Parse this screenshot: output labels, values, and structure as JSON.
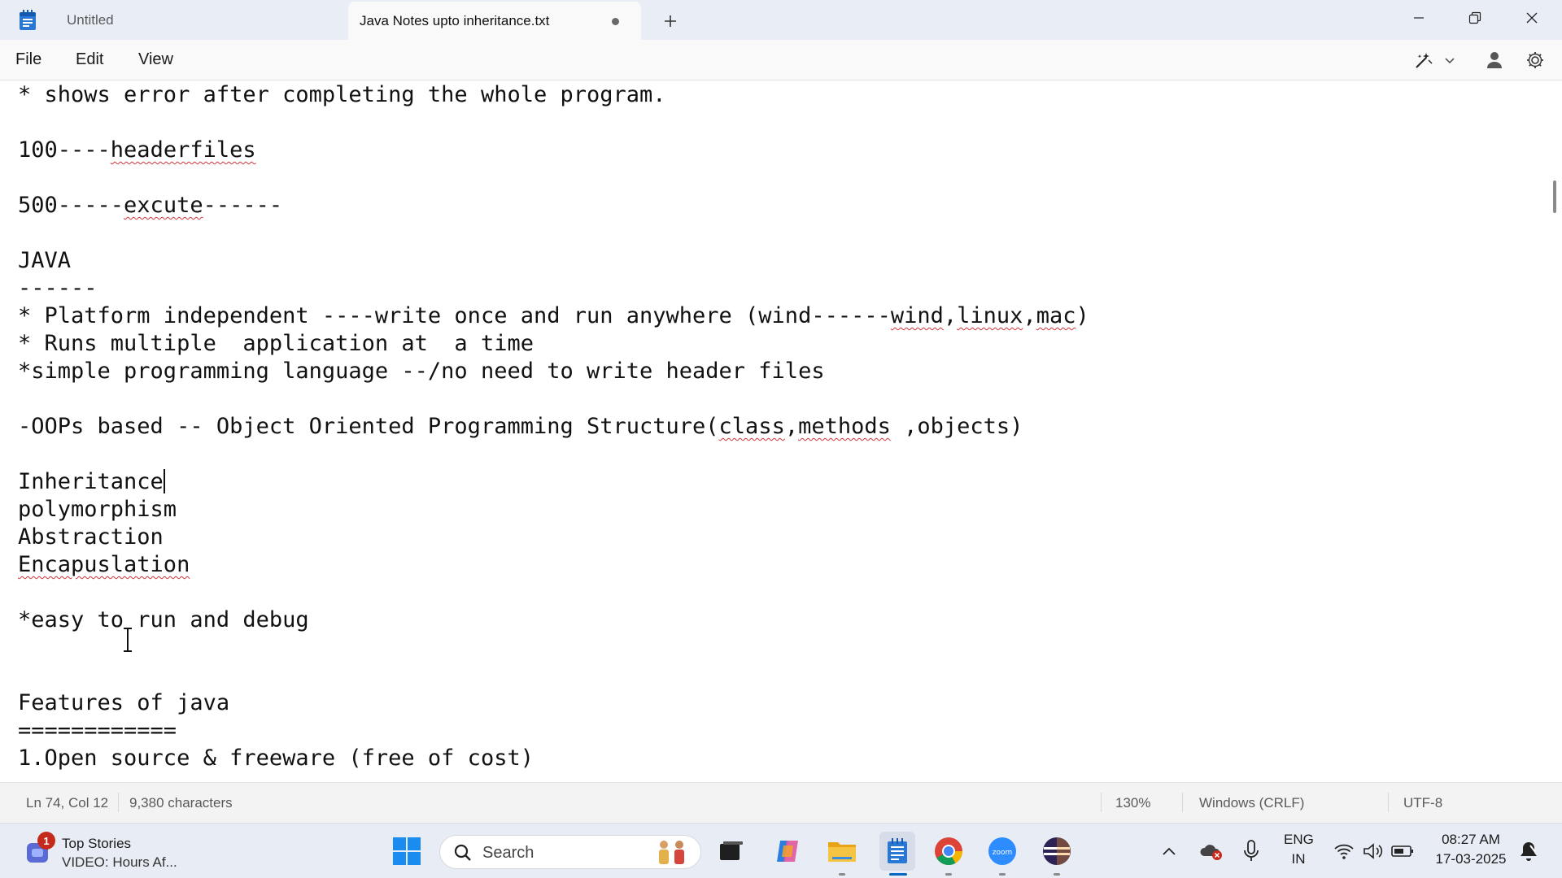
{
  "tabs": [
    {
      "label": "Untitled"
    },
    {
      "label": "Java Notes upto inheritance.txt"
    }
  ],
  "menu": {
    "file": "File",
    "edit": "Edit",
    "view": "View"
  },
  "editor_lines": [
    "* shows error after completing the whole program.",
    "",
    "100----headerfiles",
    "",
    "500-----excute------",
    "",
    "JAVA",
    "------",
    "* Platform independent ----write once and run anywhere (wind------wind,linux,mac)",
    "* Runs multiple  application at  a time",
    "*simple programming language --/no need to write header files",
    "",
    "-OOPs based -- Object Oriented Programming Structure(class,methods ,objects)",
    "",
    "Inheritance",
    "polymorphism",
    "Abstraction",
    "Encapuslation",
    "",
    "*easy to run and debug",
    "",
    "",
    "Features of java",
    "============",
    "1.Open source & freeware (free of cost)"
  ],
  "status": {
    "position": "Ln 74, Col 12",
    "characters": "9,380 characters",
    "zoom": "130%",
    "line_ending": "Windows (CRLF)",
    "encoding": "UTF-8"
  },
  "taskbar": {
    "news_badge": "1",
    "news_title": "Top Stories",
    "news_subtitle": "VIDEO: Hours Af...",
    "search_placeholder": "Search",
    "lang_top": "ENG",
    "lang_bottom": "IN",
    "time": "08:27 AM",
    "date": "17-03-2025"
  },
  "colors": {
    "accent": "#0067c0",
    "spellcheck": "#d13438"
  }
}
